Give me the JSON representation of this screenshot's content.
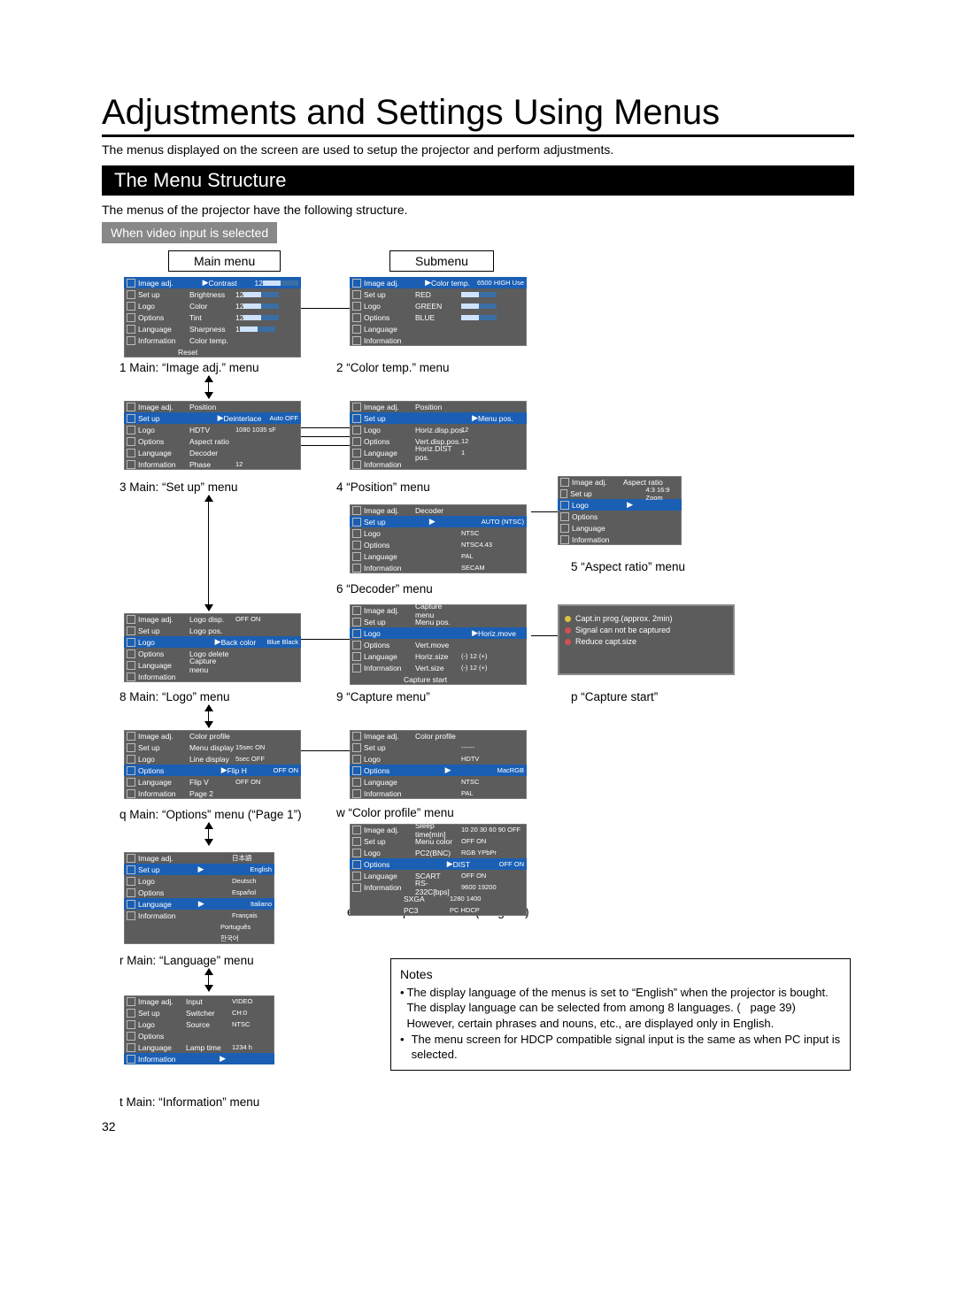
{
  "page_number": "32",
  "title": "Adjustments and Settings Using Menus",
  "intro": "The menus displayed on the screen are used to setup the projector and perform adjustments.",
  "section_bar": "The Menu Structure",
  "subtitle": "The menus of the projector have the following structure.",
  "tab": "When video input is selected",
  "labels": {
    "main": "Main menu",
    "sub": "Submenu"
  },
  "caps": {
    "c1": "1   Main: “Image adj.” menu",
    "c2": "2   “Color temp.” menu",
    "c3": "3   Main: “Set up” menu",
    "c4": "4   “Position” menu",
    "c5": "5   “Aspect ratio” menu",
    "c6": "6   “Decoder” menu",
    "c8": "8   Main: “Logo” menu",
    "c9": "9   “Capture menu”",
    "cp": "p   “Capture start”",
    "cq": "q   Main: “Options” menu (“Page 1”)",
    "cw": "w   “Color profile” menu",
    "ce": "e   Main: “Options” menu (“Page 2”)",
    "cr": "r   Main: “Language” menu",
    "ct": "t   Main: “Information” menu"
  },
  "nav": [
    "Image adj.",
    "Set up",
    "Logo",
    "Options",
    "Language",
    "Information"
  ],
  "menus": {
    "image_adj": {
      "sel": 0,
      "rows": [
        [
          "Contrast",
          "12",
          "bar"
        ],
        [
          "Brightness",
          "12",
          "bar"
        ],
        [
          "Color",
          "12",
          "bar"
        ],
        [
          "Tint",
          "12",
          "bar"
        ],
        [
          "Sharpness",
          "1",
          "bar"
        ],
        [
          "Color temp.",
          "",
          ""
        ],
        [
          "Reset",
          "",
          ""
        ]
      ]
    },
    "color_temp": {
      "sel": 0,
      "rows": [
        [
          "Color temp.",
          "6500 HIGH Use",
          ""
        ],
        [
          "RED",
          "",
          "bar"
        ],
        [
          "GREEN",
          "",
          "bar"
        ],
        [
          "BLUE",
          "",
          "bar"
        ]
      ]
    },
    "setup": {
      "sel": 1,
      "rows": [
        [
          "Position",
          "",
          ""
        ],
        [
          "Deinterlace",
          "Auto  OFF",
          ""
        ],
        [
          "HDTV",
          "1080  1035  sF",
          ""
        ],
        [
          "Aspect ratio",
          "",
          ""
        ],
        [
          "Decoder",
          "",
          ""
        ],
        [
          "Phase",
          "12",
          ""
        ]
      ]
    },
    "position": {
      "sel": 1,
      "rows": [
        [
          "Position",
          "",
          ""
        ],
        [
          "Menu pos.",
          "",
          ""
        ],
        [
          "Horiz.disp.pos.",
          "12",
          ""
        ],
        [
          "Vert.disp.pos.",
          "12",
          ""
        ],
        [
          "Horiz.DIST pos.",
          "1",
          ""
        ]
      ]
    },
    "aspect": {
      "sel": 2,
      "rows": [
        [
          "Aspect ratio",
          "",
          ""
        ],
        [
          "",
          "4:3   16:9   Zoom",
          ""
        ]
      ]
    },
    "decoder": {
      "sel": 1,
      "rows": [
        [
          "Decoder",
          "",
          ""
        ],
        [
          "",
          "AUTO   (NTSC)",
          ""
        ],
        [
          "",
          "NTSC",
          ""
        ],
        [
          "",
          "NTSC4.43",
          ""
        ],
        [
          "",
          "PAL",
          ""
        ],
        [
          "",
          "SECAM",
          ""
        ]
      ]
    },
    "logo": {
      "sel": 2,
      "rows": [
        [
          "Logo disp.",
          "OFF  ON",
          ""
        ],
        [
          "Logo pos.",
          "",
          ""
        ],
        [
          "Back color",
          "Blue  Black",
          ""
        ],
        [
          "Logo delete",
          "",
          ""
        ],
        [
          "Capture menu",
          "",
          ""
        ]
      ]
    },
    "capture": {
      "sel": 2,
      "rows": [
        [
          "Capture menu",
          "",
          ""
        ],
        [
          "Menu pos.",
          "",
          ""
        ],
        [
          "Horiz.move",
          "",
          ""
        ],
        [
          "Vert.move",
          "",
          ""
        ],
        [
          "Horiz.size",
          "(-)  12  (+)",
          ""
        ],
        [
          "Vert.size",
          "(-)  12  (+)",
          ""
        ],
        [
          "Capture start",
          "",
          ""
        ]
      ]
    },
    "capture_start": {
      "rows": [
        [
          "Capt.in prog.(approx. 2min)",
          "#e0c040"
        ],
        [
          "Signal can not be captured",
          "#d05050"
        ],
        [
          "Reduce capt.size",
          "#d05050"
        ]
      ]
    },
    "options1": {
      "sel": 3,
      "rows": [
        [
          "Color profile",
          "",
          ""
        ],
        [
          "Menu display",
          "15sec  ON",
          ""
        ],
        [
          "Line display",
          "5sec  OFF",
          ""
        ],
        [
          "Flip H",
          "OFF  ON",
          ""
        ],
        [
          "Flip V",
          "OFF  ON",
          ""
        ],
        [
          "Page 2",
          "",
          ""
        ]
      ]
    },
    "color_profile": {
      "sel": 3,
      "rows": [
        [
          "Color profile",
          "",
          ""
        ],
        [
          "",
          "------",
          ""
        ],
        [
          "",
          "HDTV",
          ""
        ],
        [
          "",
          "MacRGB",
          ""
        ],
        [
          "",
          "NTSC",
          ""
        ],
        [
          "",
          "PAL",
          ""
        ]
      ]
    },
    "options2": {
      "sel": 3,
      "rows": [
        [
          "Sleep time[min]",
          "10  20  30  60  90  OFF",
          ""
        ],
        [
          "Menu color",
          "OFF  ON",
          ""
        ],
        [
          "PC2(BNC)",
          "RGB  YPbPr",
          ""
        ],
        [
          "DIST",
          "OFF  ON",
          ""
        ],
        [
          "SCART",
          "OFF  ON",
          ""
        ],
        [
          "RS-232C[bps]",
          "9600  19200",
          ""
        ],
        [
          "SXGA",
          "1280  1400",
          ""
        ],
        [
          "PC3",
          "PC  HDCP",
          ""
        ]
      ]
    },
    "language": {
      "sel": 4,
      "rows": [
        [
          "",
          "日本語",
          ""
        ],
        [
          "",
          "English",
          "sel"
        ],
        [
          "",
          "Deutsch",
          ""
        ],
        [
          "",
          "Español",
          ""
        ],
        [
          "",
          "Italiano",
          ""
        ],
        [
          "",
          "Français",
          ""
        ],
        [
          "",
          "Português",
          ""
        ],
        [
          "",
          "한국어",
          ""
        ]
      ]
    },
    "information": {
      "sel": 5,
      "rows": [
        [
          "Input",
          "VIDEO",
          ""
        ],
        [
          "Switcher",
          "CH:0",
          ""
        ],
        [
          "Source",
          "NTSC",
          ""
        ],
        [
          "",
          "",
          ""
        ],
        [
          "Lamp time",
          "1234 h",
          ""
        ]
      ]
    }
  },
  "notes": {
    "title": "Notes",
    "b1a": "The display language of the menus is set to “English” when the projector is bought. The display language can be selected from among 8 languages. (   page 39)",
    "b1b": "However, certain phrases and nouns, etc., are displayed only in English.",
    "b2": "The menu screen for HDCP compatible signal input is the same as when PC input is selected."
  }
}
